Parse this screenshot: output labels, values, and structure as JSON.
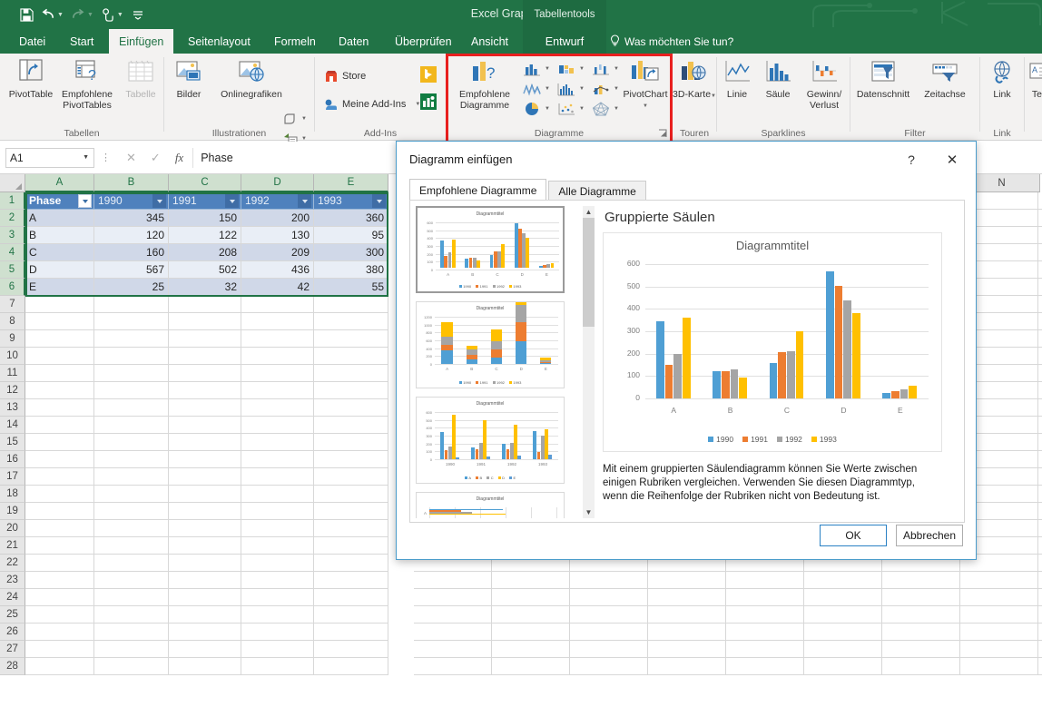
{
  "window": {
    "title": "Excel Graph - Excel",
    "contextual_tab_title": "Tabellentools",
    "quick_access": [
      {
        "name": "save-icon",
        "glyph": "ὋE"
      },
      {
        "name": "undo-icon",
        "glyph": "↶"
      },
      {
        "name": "redo-icon",
        "glyph": "↷"
      },
      {
        "name": "touch-mode-icon",
        "glyph": "☝"
      },
      {
        "name": "customize-qat-icon",
        "glyph": "⌄"
      }
    ]
  },
  "ribbon": {
    "tabs": [
      {
        "label": "Datei",
        "active": false
      },
      {
        "label": "Start",
        "active": false
      },
      {
        "label": "Einfügen",
        "active": true
      },
      {
        "label": "Seitenlayout",
        "active": false
      },
      {
        "label": "Formeln",
        "active": false
      },
      {
        "label": "Daten",
        "active": false
      },
      {
        "label": "Überprüfen",
        "active": false
      },
      {
        "label": "Ansicht",
        "active": false
      },
      {
        "label": "Entwurf",
        "active": false,
        "contextual": true
      }
    ],
    "tell_me": "Was möchten Sie tun?",
    "groups": [
      {
        "name": "Tabellen",
        "label": "Tabellen",
        "buttons": [
          {
            "label": "PivotTable",
            "icon": "pivottable-icon",
            "disabled": false
          },
          {
            "label": "Empfohlene PivotTables",
            "icon": "recommended-pivottables-icon",
            "disabled": false
          },
          {
            "label": "Tabelle",
            "icon": "table-icon",
            "disabled": true
          }
        ]
      },
      {
        "name": "Illustrationen",
        "label": "Illustrationen",
        "buttons": [
          {
            "label": "Bilder",
            "icon": "pictures-icon"
          },
          {
            "label": "Onlinegrafiken",
            "icon": "online-pictures-icon"
          }
        ],
        "small_buttons": [
          {
            "label": "",
            "icon": "shapes-icon"
          },
          {
            "label": "",
            "icon": "smartart-icon"
          },
          {
            "label": "",
            "icon": "screenshot-icon"
          }
        ]
      },
      {
        "name": "Add-Ins",
        "label": "Add-Ins",
        "items": [
          {
            "label": "Store",
            "icon": "store-icon"
          },
          {
            "label": "Meine Add-Ins",
            "icon": "my-addins-icon"
          }
        ],
        "extra_icons": [
          {
            "name": "bing-maps-icon"
          },
          {
            "name": "people-graph-icon"
          }
        ]
      },
      {
        "name": "Diagramme",
        "label": "Diagramme",
        "highlighted": true,
        "buttons": [
          {
            "label": "Empfohlene Diagramme",
            "icon": "recommended-charts-icon"
          },
          {
            "label": "PivotChart",
            "icon": "pivotchart-icon"
          }
        ],
        "chart_types": [
          {
            "name": "column-chart-icon"
          },
          {
            "name": "hierarchy-chart-icon"
          },
          {
            "name": "waterfall-chart-icon"
          },
          {
            "name": "stock-chart-icon"
          },
          {
            "name": "statistic-chart-icon"
          },
          {
            "name": "combo-chart-icon"
          },
          {
            "name": "pie-chart-icon"
          },
          {
            "name": "scatter-chart-icon"
          },
          {
            "name": "radar-chart-icon"
          }
        ]
      },
      {
        "name": "Touren",
        "label": "Touren",
        "buttons": [
          {
            "label": "3D-Karte",
            "icon": "3d-map-icon"
          }
        ]
      },
      {
        "name": "Sparklines",
        "label": "Sparklines",
        "buttons": [
          {
            "label": "Linie",
            "icon": "sparkline-line-icon"
          },
          {
            "label": "Säule",
            "icon": "sparkline-column-icon"
          },
          {
            "label": "Gewinn/ Verlust",
            "icon": "sparkline-winloss-icon"
          }
        ]
      },
      {
        "name": "Filter",
        "label": "Filter",
        "buttons": [
          {
            "label": "Datenschnitt",
            "icon": "slicer-icon"
          },
          {
            "label": "Zeitachse",
            "icon": "timeline-icon"
          }
        ]
      },
      {
        "name": "Link",
        "label": "Link",
        "buttons": [
          {
            "label": "Link",
            "icon": "hyperlink-icon"
          }
        ]
      },
      {
        "name": "Text",
        "label": "",
        "buttons": [
          {
            "label": "Textf",
            "icon": "textbox-icon"
          }
        ]
      }
    ]
  },
  "formula_bar": {
    "name_box": "A1",
    "cancel_icon": "cancel-icon",
    "confirm_icon": "confirm-icon",
    "fx_label": "fx",
    "content": "Phase"
  },
  "sheet": {
    "columns": [
      "A",
      "B",
      "C",
      "D",
      "E"
    ],
    "right_column": "N",
    "row_numbers": [
      1,
      2,
      3,
      4,
      5,
      6,
      7,
      8,
      9,
      10,
      11,
      12,
      13,
      14,
      15,
      16,
      17,
      18,
      19,
      20,
      21,
      22,
      23,
      24,
      25,
      26,
      27,
      28
    ],
    "table": {
      "headers": [
        "Phase",
        "1990",
        "1991",
        "1992",
        "1993"
      ],
      "rows": [
        {
          "phase": "A",
          "values": [
            345,
            150,
            200,
            360
          ]
        },
        {
          "phase": "B",
          "values": [
            120,
            122,
            130,
            95
          ]
        },
        {
          "phase": "C",
          "values": [
            160,
            208,
            209,
            300
          ]
        },
        {
          "phase": "D",
          "values": [
            567,
            502,
            436,
            380
          ]
        },
        {
          "phase": "E",
          "values": [
            25,
            32,
            42,
            55
          ]
        }
      ]
    }
  },
  "dialog": {
    "title": "Diagramm einfügen",
    "help_icon": "help-icon",
    "close_icon": "close-icon",
    "tabs": [
      {
        "label": "Empfohlene Diagramme",
        "active": true
      },
      {
        "label": "Alle Diagramme",
        "active": false
      }
    ],
    "preview_title": "Gruppierte Säulen",
    "description": "Mit einem gruppierten Säulendiagramm können Sie Werte zwischen einigen Rubriken vergleichen. Verwenden Sie diesen Diagrammtyp, wenn die Reihenfolge der Rubriken nicht von Bedeutung ist.",
    "thumbnail_title": "Diagrammtitel",
    "thumbnails": [
      {
        "type": "clustered-column",
        "selected": true
      },
      {
        "type": "stacked-column",
        "selected": false
      },
      {
        "type": "clustered-column-transposed",
        "selected": false
      },
      {
        "type": "clustered-bar",
        "selected": false
      },
      {
        "type": "stacked-column-2",
        "selected": false
      }
    ],
    "scroll_up_icon": "chevron-up-icon",
    "scroll_down_icon": "chevron-down-icon",
    "ok_label": "OK",
    "cancel_label": "Abbrechen"
  },
  "colors": {
    "excel_green": "#217346",
    "series_1990": "#4f9fd4",
    "series_1991": "#ed7d31",
    "series_1992": "#a5a5a5",
    "series_1993": "#ffc000",
    "highlight_red": "#e8201f",
    "table_header_blue": "#4f81bd"
  },
  "chart_data": {
    "type": "bar",
    "title": "Diagrammtitel",
    "categories": [
      "A",
      "B",
      "C",
      "D",
      "E"
    ],
    "series": [
      {
        "name": "1990",
        "color": "#4f9fd4",
        "values": [
          345,
          120,
          160,
          567,
          25
        ]
      },
      {
        "name": "1991",
        "color": "#ed7d31",
        "values": [
          150,
          122,
          208,
          502,
          32
        ]
      },
      {
        "name": "1992",
        "color": "#a5a5a5",
        "values": [
          200,
          130,
          209,
          436,
          42
        ]
      },
      {
        "name": "1993",
        "color": "#ffc000",
        "values": [
          360,
          95,
          300,
          380,
          55
        ]
      }
    ],
    "xlabel": "",
    "ylabel": "",
    "ylim": [
      0,
      600
    ],
    "yticks": [
      0,
      100,
      200,
      300,
      400,
      500,
      600
    ],
    "grid": true,
    "legend_position": "bottom"
  }
}
